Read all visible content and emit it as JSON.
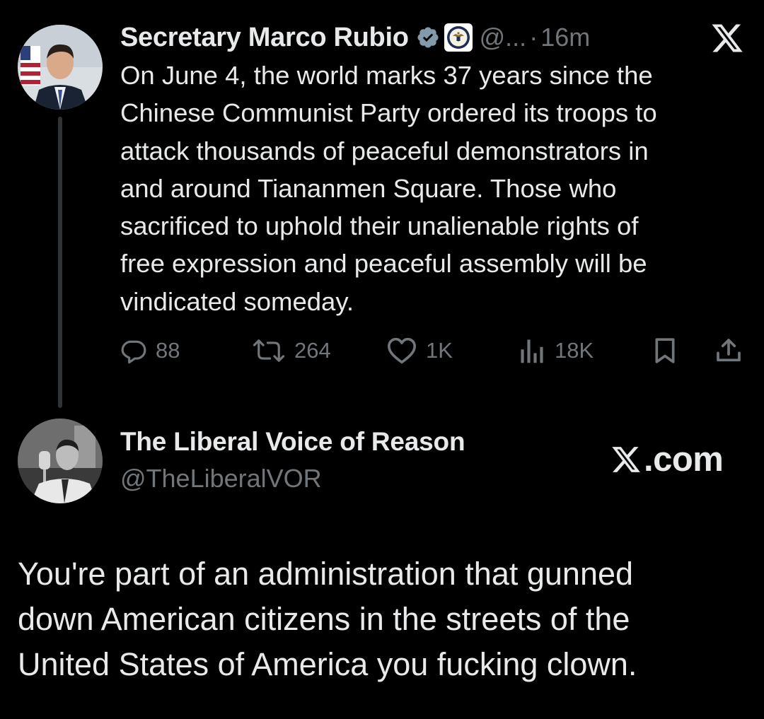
{
  "original_tweet": {
    "author_name": "Secretary Marco Rubio",
    "handle": "@...",
    "separator": "·",
    "time": "16m",
    "body": "On June 4, the world marks 37 years since the\nChinese Communist Party ordered its troops to\nattack thousands of peaceful demonstrators in\nand around Tiananmen Square.  Those who\nsacrificed to uphold their unalienable rights of\nfree expression and peaceful assembly will be\nvindicated someday.",
    "stats": {
      "replies": "88",
      "reposts": "264",
      "likes": "1K",
      "views": "18K"
    },
    "icons": {
      "verified": "verified-badge-icon",
      "seal": "state-department-seal-icon",
      "brand": "x-logo-icon",
      "reply": "reply-icon",
      "repost": "repost-icon",
      "like": "heart-icon",
      "views": "views-chart-icon",
      "bookmark": "bookmark-icon",
      "share": "share-icon"
    }
  },
  "reply_card": {
    "author_name": "The Liberal Voice of Reason",
    "handle": "@TheLiberalVOR",
    "site_label_prefix": "X",
    "site_label_rest": ".com",
    "body": "You're part of an administration that gunned\ndown American citizens in the streets of the\nUnited States of America you fucking clown."
  },
  "colors": {
    "background": "#000000",
    "primary_text": "#e7e9ea",
    "secondary_text": "#71767b",
    "thread_line": "#2f3336",
    "verified_badge": "#829aab"
  }
}
